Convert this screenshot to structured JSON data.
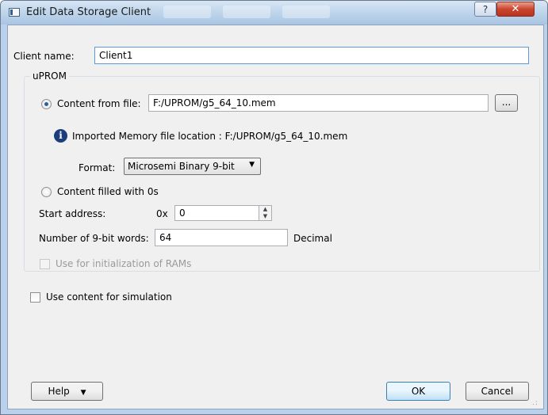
{
  "window": {
    "title": "Edit Data Storage Client",
    "help_button": "?",
    "close_button": "✕"
  },
  "client_name": {
    "label": "Client name:",
    "value": "Client1"
  },
  "uprom": {
    "legend": "uPROM",
    "content_from_file": {
      "label": "Content from file:",
      "selected": true,
      "path": "F:/UPROM/g5_64_10.mem",
      "browse_label": "..."
    },
    "imported_info": "Imported Memory file location : F:/UPROM/g5_64_10.mem",
    "format": {
      "label": "Format:",
      "value": "Microsemi Binary 9-bit"
    },
    "content_zeros": {
      "label": "Content filled with 0s",
      "selected": false
    },
    "start_address": {
      "label": "Start address:",
      "prefix": "0x",
      "value": "0"
    },
    "word_count": {
      "label": "Number of 9-bit words:",
      "value": "64",
      "unit": "Decimal"
    },
    "init_rams": {
      "label": "Use for initialization of RAMs",
      "checked": false,
      "enabled": false
    }
  },
  "simulation": {
    "label": "Use content for simulation",
    "checked": false
  },
  "footer": {
    "help_label": "Help",
    "ok_label": "OK",
    "cancel_label": "Cancel"
  },
  "colors": {
    "title_bar": "#bcd3ea",
    "close_button": "#c9452e",
    "dialog_background": "#f0f0f0",
    "info_icon": "#1c3c7c",
    "default_button_border": "#3c7fb1"
  }
}
